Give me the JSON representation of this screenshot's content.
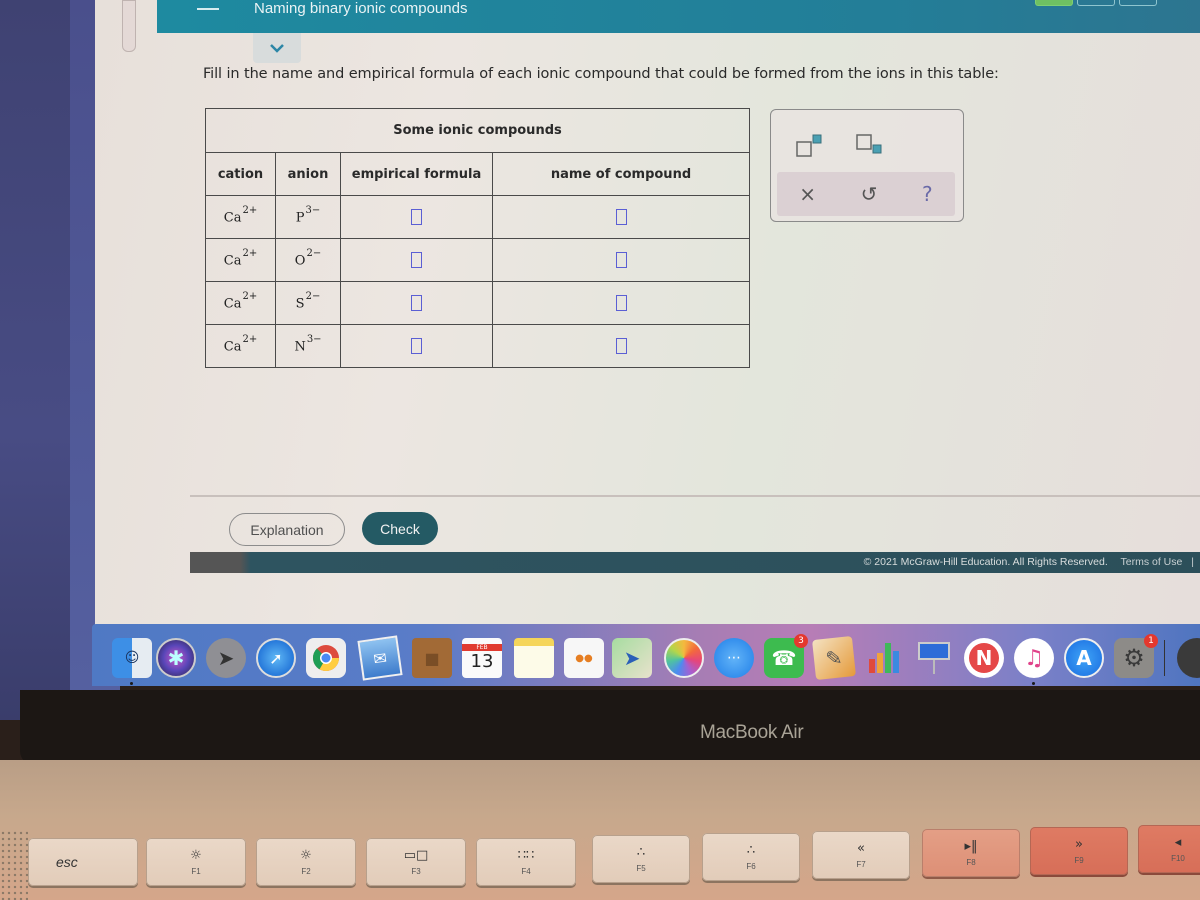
{
  "window": {
    "title": "Naming binary ionic compounds"
  },
  "question": {
    "prompt": "Fill in the name and empirical formula of each ionic compound that could be formed from the ions in this table:"
  },
  "table": {
    "caption": "Some ionic compounds",
    "headers": [
      "cation",
      "anion",
      "empirical formula",
      "name of compound"
    ],
    "rows": [
      {
        "cation": {
          "symbol": "Ca",
          "charge": "2+"
        },
        "anion": {
          "symbol": "P",
          "charge": "3−"
        },
        "empirical_formula": "",
        "name": ""
      },
      {
        "cation": {
          "symbol": "Ca",
          "charge": "2+"
        },
        "anion": {
          "symbol": "O",
          "charge": "2−"
        },
        "empirical_formula": "",
        "name": ""
      },
      {
        "cation": {
          "symbol": "Ca",
          "charge": "2+"
        },
        "anion": {
          "symbol": "S",
          "charge": "2−"
        },
        "empirical_formula": "",
        "name": ""
      },
      {
        "cation": {
          "symbol": "Ca",
          "charge": "2+"
        },
        "anion": {
          "symbol": "N",
          "charge": "3−"
        },
        "empirical_formula": "",
        "name": ""
      }
    ]
  },
  "palette": {
    "tools": [
      "superscript-icon",
      "subscript-icon"
    ],
    "actions": [
      {
        "icon": "close-icon",
        "glyph": "×"
      },
      {
        "icon": "undo-icon",
        "glyph": "↺"
      },
      {
        "icon": "help-icon",
        "glyph": "?"
      }
    ]
  },
  "buttons": {
    "explanation": "Explanation",
    "check": "Check"
  },
  "footer": {
    "copyright": "© 2021 McGraw-Hill Education. All Rights Reserved.",
    "terms": "Terms of Use",
    "separator": "|"
  },
  "dock": {
    "apps": [
      {
        "name": "Finder"
      },
      {
        "name": "Siri"
      },
      {
        "name": "Launchpad"
      },
      {
        "name": "Safari"
      },
      {
        "name": "Chrome"
      },
      {
        "name": "Mail"
      },
      {
        "name": "Contacts"
      },
      {
        "name": "Calendar",
        "month": "FEB",
        "day": "13"
      },
      {
        "name": "Notes"
      },
      {
        "name": "Reminders"
      },
      {
        "name": "Maps"
      },
      {
        "name": "Photos"
      },
      {
        "name": "Messages"
      },
      {
        "name": "FaceTime",
        "badge": "3"
      },
      {
        "name": "Pages"
      },
      {
        "name": "Numbers"
      },
      {
        "name": "Keynote"
      },
      {
        "name": "News"
      },
      {
        "name": "Music"
      },
      {
        "name": "App Store"
      },
      {
        "name": "System Preferences",
        "badge": "1"
      }
    ]
  },
  "device": {
    "label": "MacBook Air"
  },
  "keyboard": {
    "keys": [
      {
        "label": "esc",
        "glyph": ""
      },
      {
        "label": "F1",
        "glyph": "☼"
      },
      {
        "label": "F2",
        "glyph": "☼"
      },
      {
        "label": "F3",
        "glyph": "▭□"
      },
      {
        "label": "F4",
        "glyph": "∷∷"
      },
      {
        "label": "F5",
        "glyph": "∴"
      },
      {
        "label": "F6",
        "glyph": "∴"
      },
      {
        "label": "F7",
        "glyph": "«"
      },
      {
        "label": "F8",
        "glyph": "▸‖"
      },
      {
        "label": "F9",
        "glyph": "»"
      },
      {
        "label": "F10",
        "glyph": "◂"
      }
    ]
  }
}
